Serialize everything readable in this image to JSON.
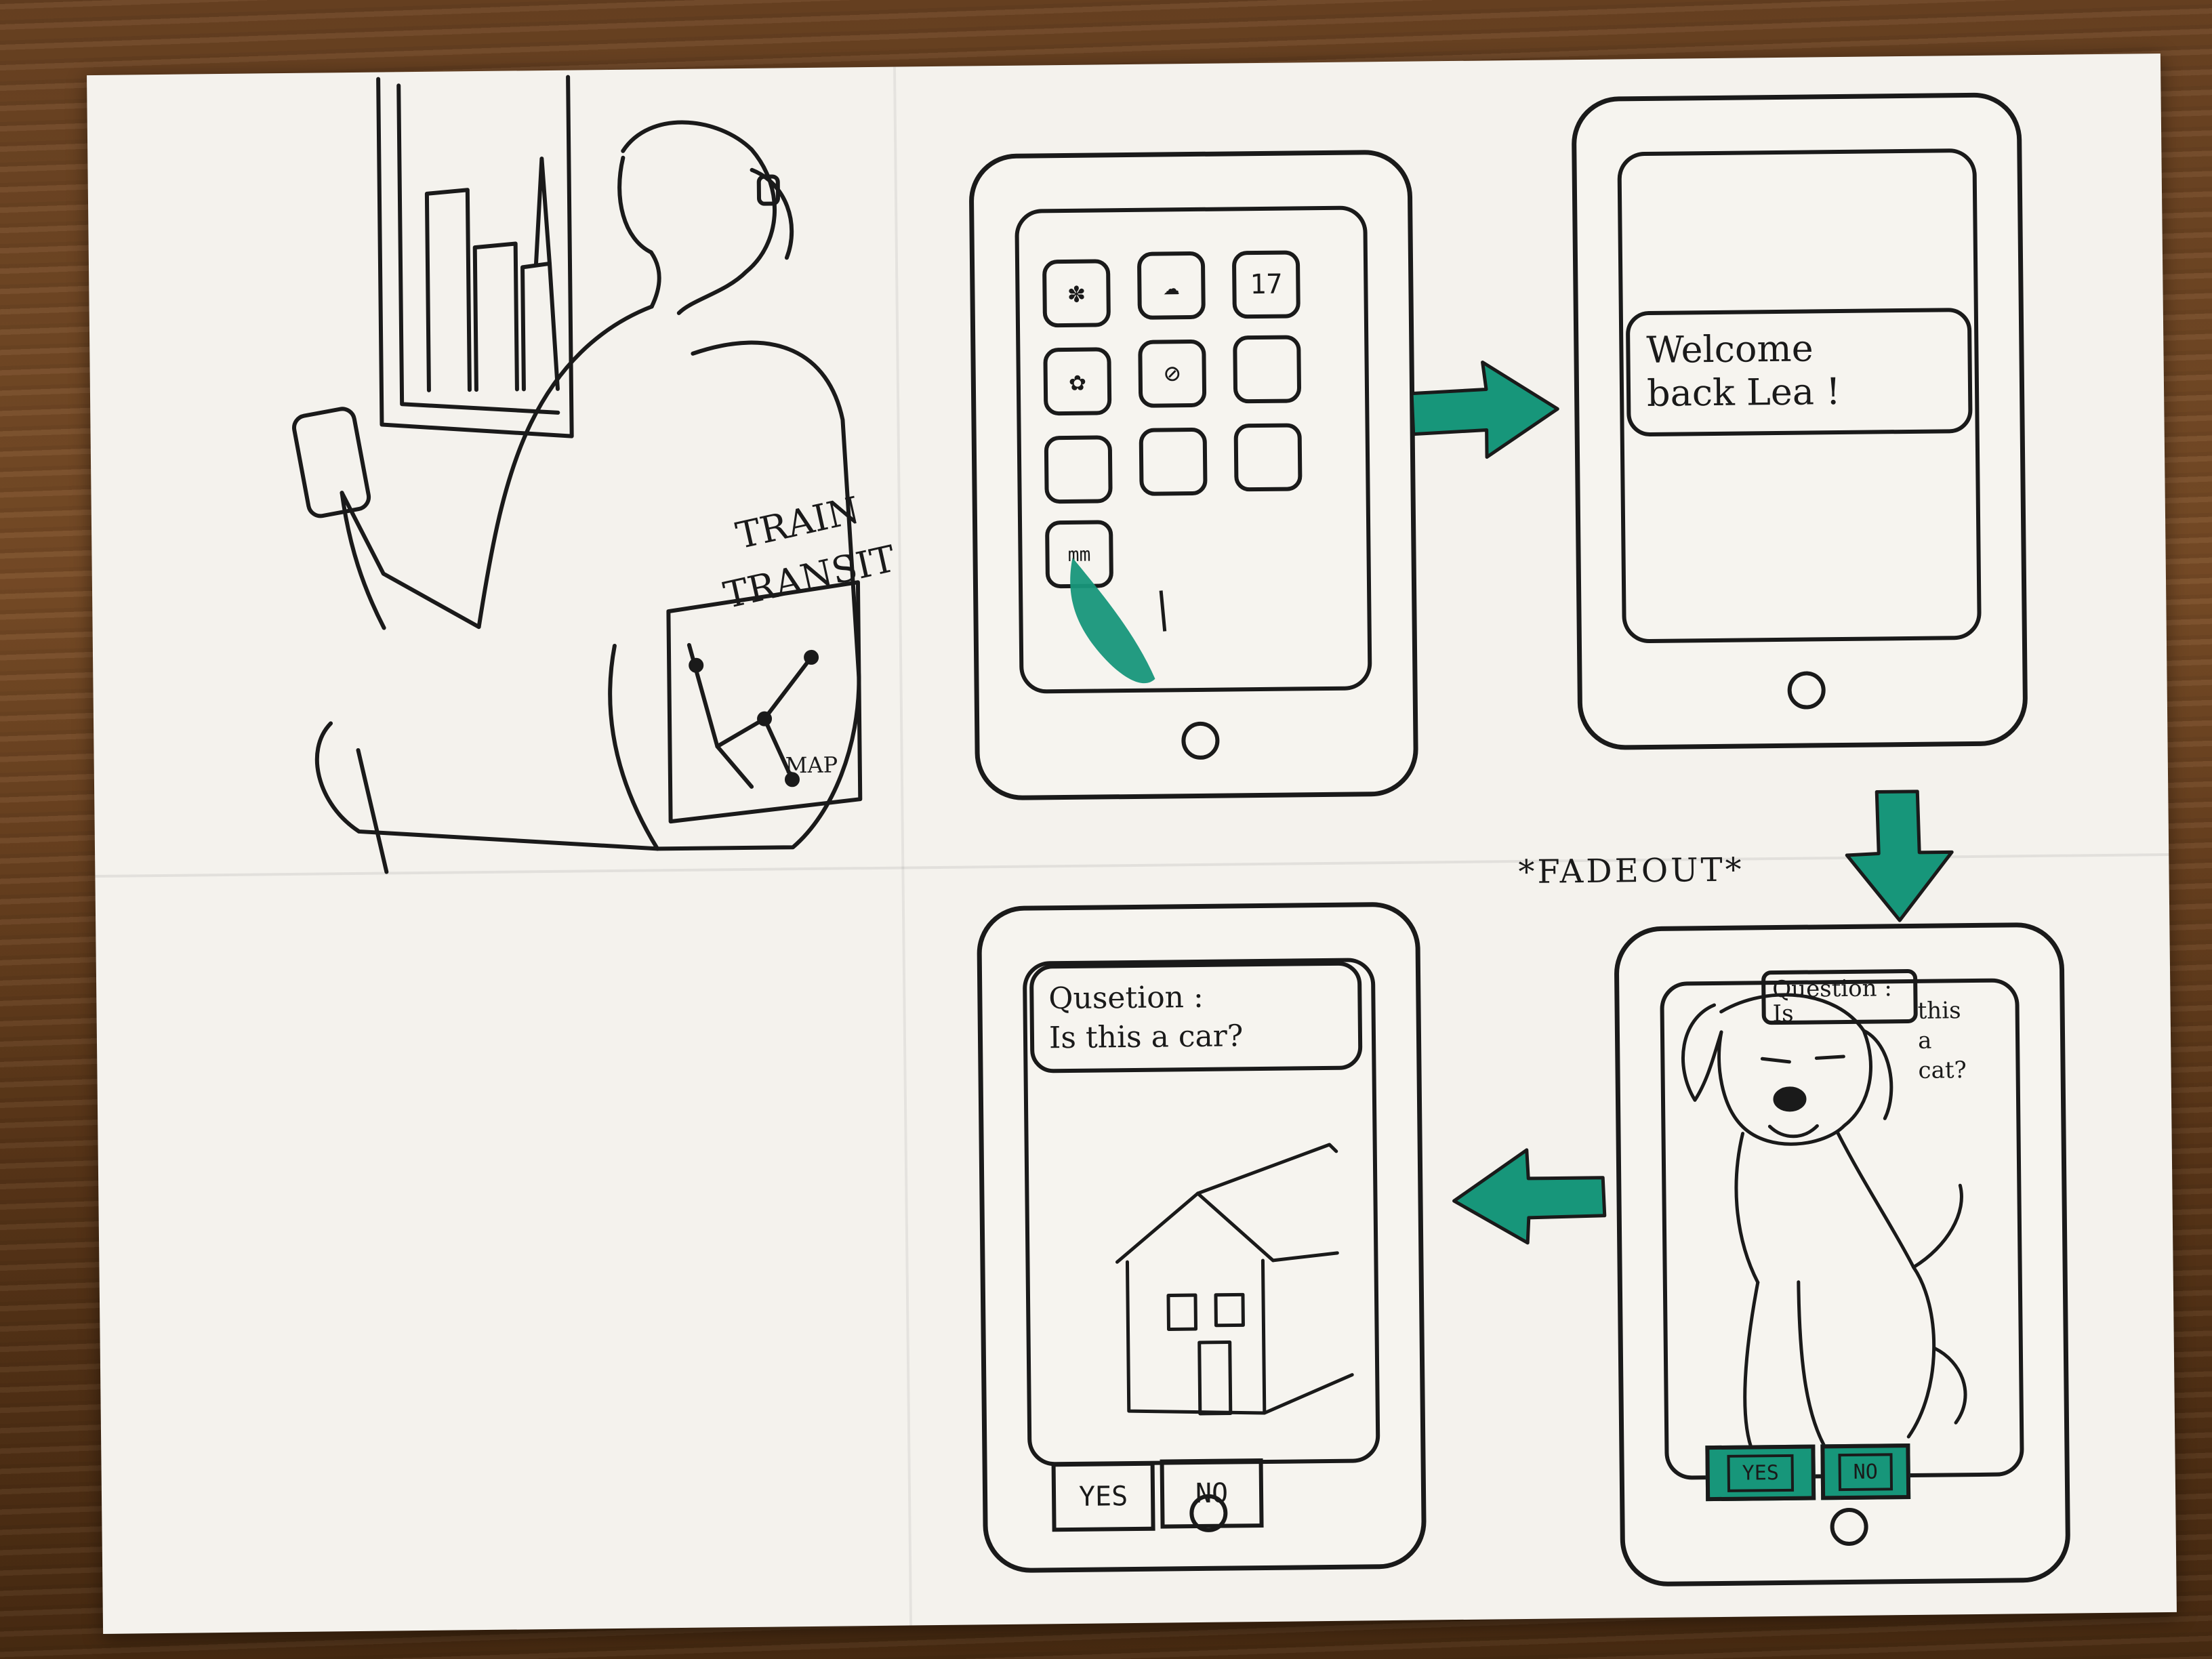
{
  "colors": {
    "ink": "#1a1a1a",
    "marker": "#17967a",
    "paper": "#f4f2ed"
  },
  "panel1": {
    "chair_text": [
      "TRAIN",
      "TRANSIT"
    ],
    "map_label": "MAP"
  },
  "panel2": {
    "icons": [
      {
        "name": "fan-icon",
        "label": ""
      },
      {
        "name": "cloud-icon",
        "label": ""
      },
      {
        "name": "calendar-icon",
        "label": "17"
      },
      {
        "name": "flower-icon",
        "label": ""
      },
      {
        "name": "compass-icon",
        "label": ""
      },
      {
        "name": "blank-app-icon",
        "label": ""
      },
      {
        "name": "blank-app-icon",
        "label": ""
      },
      {
        "name": "blank-app-icon",
        "label": ""
      },
      {
        "name": "blank-app-icon",
        "label": ""
      },
      {
        "name": "train-app-icon",
        "label": "mm"
      }
    ]
  },
  "panel3": {
    "welcome_lines": [
      "Welcome",
      "back Lea !"
    ]
  },
  "panel4": {
    "question_lines": [
      "Question : Is",
      "this",
      "a",
      "cat?"
    ],
    "yes": "YES",
    "no": "NO"
  },
  "panel5": {
    "question_lines": [
      "Qusetion :",
      "Is this a car?"
    ],
    "yes": "YES",
    "no": "NO"
  },
  "annotation": "*FADEOUT*"
}
